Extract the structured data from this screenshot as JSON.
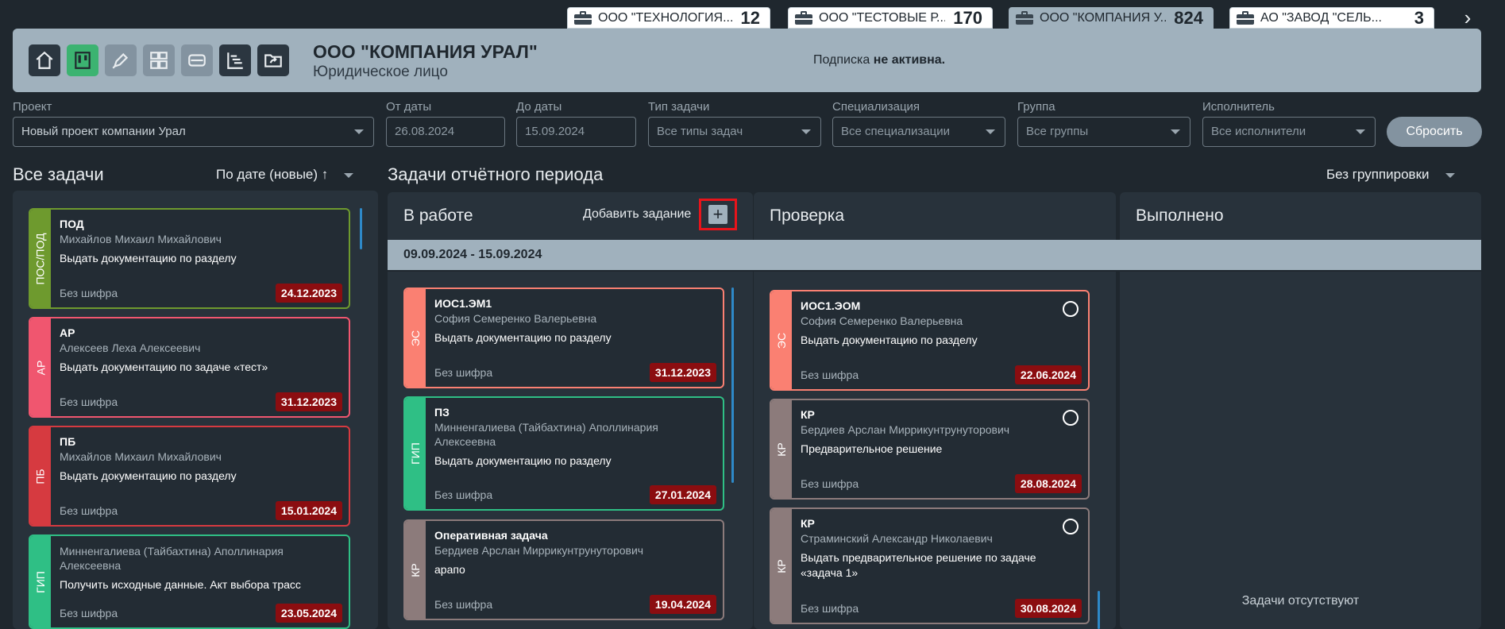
{
  "company_tabs": [
    {
      "name": "ООО \"ТЕХНОЛОГИЯ...",
      "count": "12"
    },
    {
      "name": "ООО \"ТЕСТОВЫЕ Р...",
      "count": "170"
    },
    {
      "name": "ООО \"КОМПАНИЯ У...",
      "count": "824"
    },
    {
      "name": "АО \"ЗАВОД \"СЕЛЬ...",
      "count": "3"
    }
  ],
  "header": {
    "company_name": "ООО \"КОМПАНИЯ УРАЛ\"",
    "company_type": "Юридическое лицо",
    "subscription_label": "Подписка",
    "subscription_status": "не активна."
  },
  "filters": {
    "project": {
      "label": "Проект",
      "value": "Новый проект компании Урал"
    },
    "date_from": {
      "label": "От даты",
      "placeholder": "26.08.2024"
    },
    "date_to": {
      "label": "До даты",
      "placeholder": "15.09.2024"
    },
    "task_type": {
      "label": "Тип задачи",
      "value": "Все типы задач"
    },
    "specialization": {
      "label": "Специализация",
      "value": "Все специализации"
    },
    "group": {
      "label": "Группа",
      "value": "Все группы"
    },
    "executor": {
      "label": "Исполнитель",
      "value": "Все исполнители"
    },
    "reset_label": "Сбросить"
  },
  "all_tasks": {
    "title": "Все задачи",
    "sort": "По дате (новые) ↑",
    "cards": [
      {
        "tag": "ПОС/ПОД",
        "color": "#6e9a2e",
        "code": "ПОД",
        "person": "Михайлов Михаил Михайлович",
        "desc": "Выдать документацию по разделу",
        "cipher": "Без шифра",
        "date": "24.12.2023"
      },
      {
        "tag": "АР",
        "color": "#f0566f",
        "code": "АР",
        "person": "Алексеев Леха Алексеевич",
        "desc": "Выдать документацию по задаче «тест»",
        "cipher": "Без шифра",
        "date": "31.12.2023"
      },
      {
        "tag": "ПБ",
        "color": "#d63a40",
        "code": "ПБ",
        "person": "Михайлов Михаил Михайлович",
        "desc": "Выдать документацию по разделу",
        "cipher": "Без шифра",
        "date": "15.01.2024"
      },
      {
        "tag": "ГИП",
        "color": "#2fbf85",
        "code": "",
        "person": "Минненгалиева (Тайбахтина) Аполлинария Алексеевна",
        "desc": "Получить исходные данные. Акт выбора трасс",
        "cipher": "Без шифра",
        "date": "23.05.2024"
      }
    ]
  },
  "period_section": {
    "title": "Задачи отчётного периода",
    "grouping": "Без группировки",
    "period": "09.09.2024 - 15.09.2024",
    "add_task_label": "Добавить задание",
    "add_icon": "+"
  },
  "columns": {
    "in_work": {
      "title": "В работе",
      "cards": [
        {
          "tag": "ЭС",
          "color": "#fa8072",
          "code": "ИОС1.ЭМ1",
          "person": "София Семеренко Валерьевна",
          "desc": "Выдать документацию по разделу",
          "cipher": "Без шифра",
          "date": "31.12.2023"
        },
        {
          "tag": "ГИП",
          "color": "#2fbf85",
          "code": "ПЗ",
          "person": "Минненгалиева (Тайбахтина) Аполлинария Алексеевна",
          "desc": "Выдать документацию по разделу",
          "cipher": "Без шифра",
          "date": "27.01.2024"
        },
        {
          "tag": "КР",
          "color": "#8c7b7b",
          "code": "Оперативная задача",
          "person": "Бердиев Арслан Миррикунтрунуторович",
          "desc": "арапо",
          "cipher": "Без шифра",
          "date": "19.04.2024"
        }
      ]
    },
    "review": {
      "title": "Проверка",
      "cards": [
        {
          "tag": "ЭС",
          "color": "#fa8072",
          "code": "ИОС1.ЭОМ",
          "person": "София Семеренко Валерьевна",
          "desc": "Выдать документацию по разделу",
          "cipher": "Без шифра",
          "date": "22.06.2024"
        },
        {
          "tag": "КР",
          "color": "#8c7b7b",
          "code": "КР",
          "person": "Бердиев Арслан Миррикунтрунуторович",
          "desc": "Предварительное решение",
          "cipher": "Без шифра",
          "date": "28.08.2024"
        },
        {
          "tag": "КР",
          "color": "#8c7b7b",
          "code": "КР",
          "person": "Страминский Александр Николаевич",
          "desc": "Выдать предварительное решение по задаче «задача 1»",
          "cipher": "Без шифра",
          "date": "30.08.2024"
        }
      ]
    },
    "done": {
      "title": "Выполнено",
      "empty": "Задачи отсутствуют"
    }
  },
  "toolbar_icons": [
    "home-icon",
    "kanban-icon",
    "pen-icon",
    "grid-icon",
    "card-icon",
    "gantt-icon",
    "folder-share-icon"
  ]
}
